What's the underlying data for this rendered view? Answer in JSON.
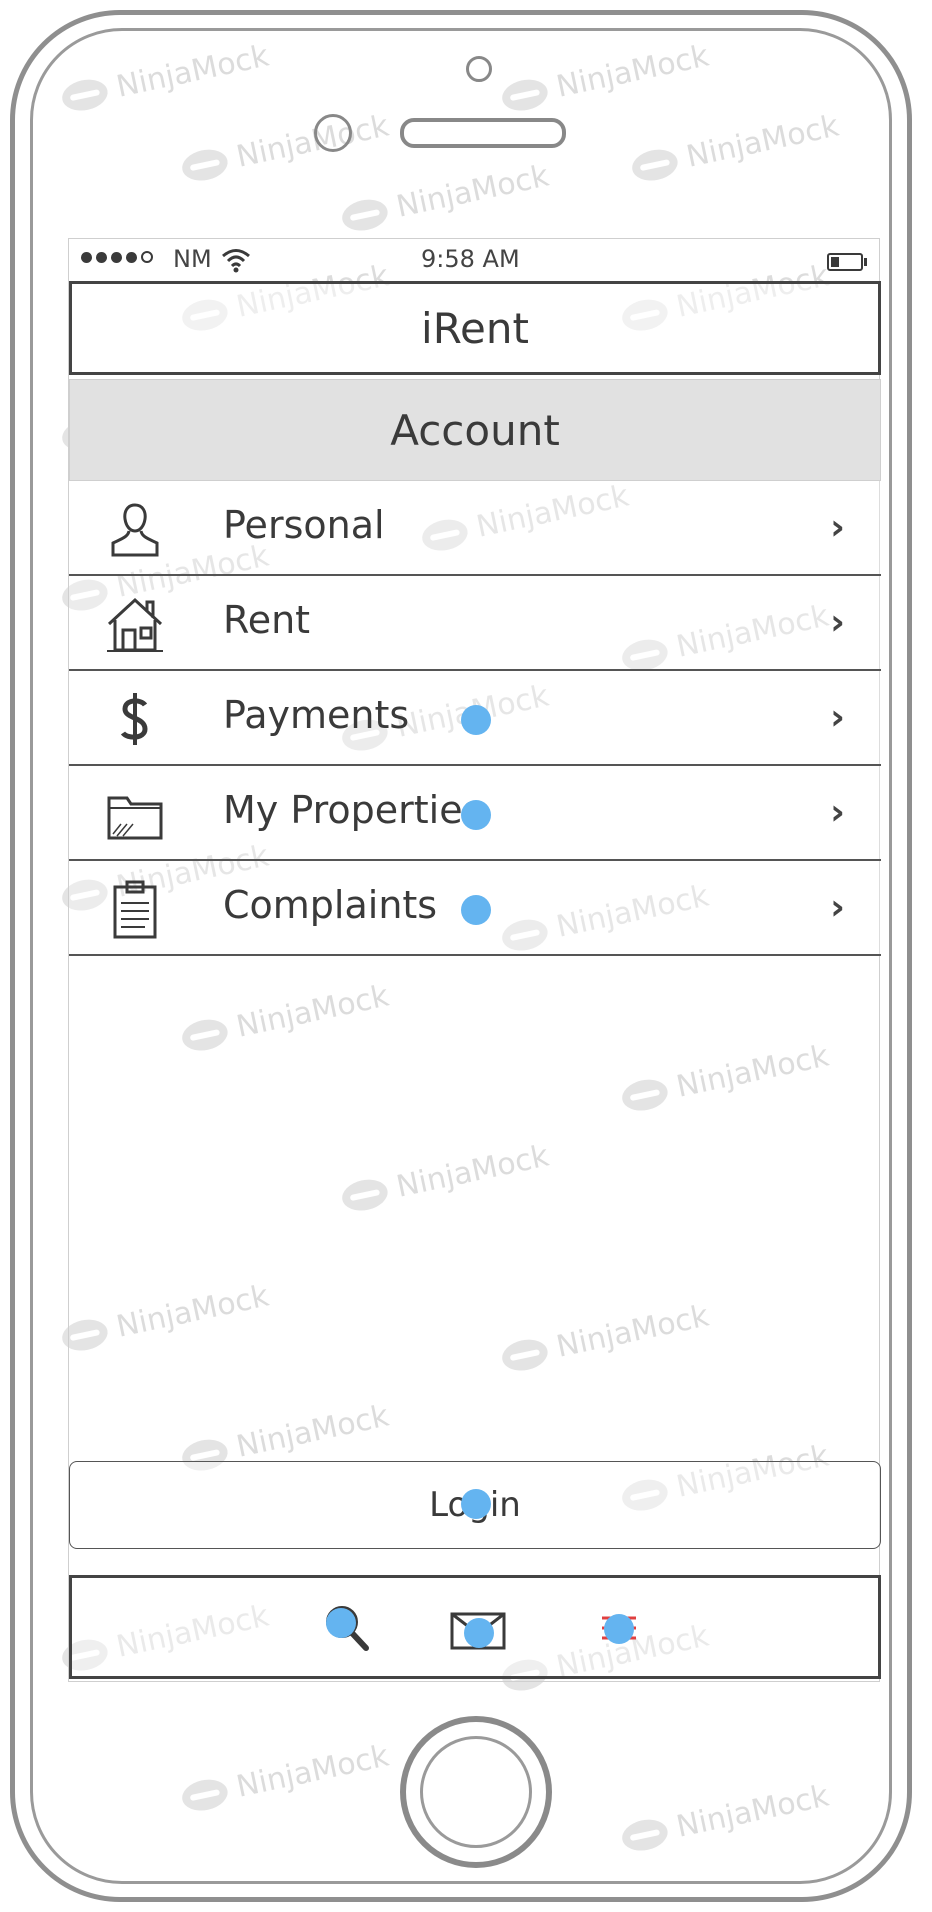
{
  "watermark": "NinjaMock",
  "status_bar": {
    "carrier": "NM",
    "time": "9:58 AM"
  },
  "app": {
    "title": "iRent"
  },
  "section": {
    "title": "Account"
  },
  "menu": {
    "items": [
      {
        "label": "Personal",
        "icon": "person-icon",
        "chevron": "›"
      },
      {
        "label": "Rent",
        "icon": "house-icon",
        "chevron": "›"
      },
      {
        "label": "Payments",
        "icon": "dollar-icon",
        "chevron": "›"
      },
      {
        "label": "My Properties",
        "icon": "folder-icon",
        "chevron": "›"
      },
      {
        "label": "Complaints",
        "icon": "clipboard-icon",
        "chevron": "›"
      }
    ]
  },
  "login": {
    "label": "Login"
  },
  "tab_bar": {
    "tabs": [
      {
        "icon": "search-icon"
      },
      {
        "icon": "mail-icon"
      },
      {
        "icon": "menu-icon"
      }
    ]
  },
  "colors": {
    "hotspot": "#64b4f0",
    "header_bg": "#e1e1e1",
    "menu_icon_accent": "#e04040"
  }
}
